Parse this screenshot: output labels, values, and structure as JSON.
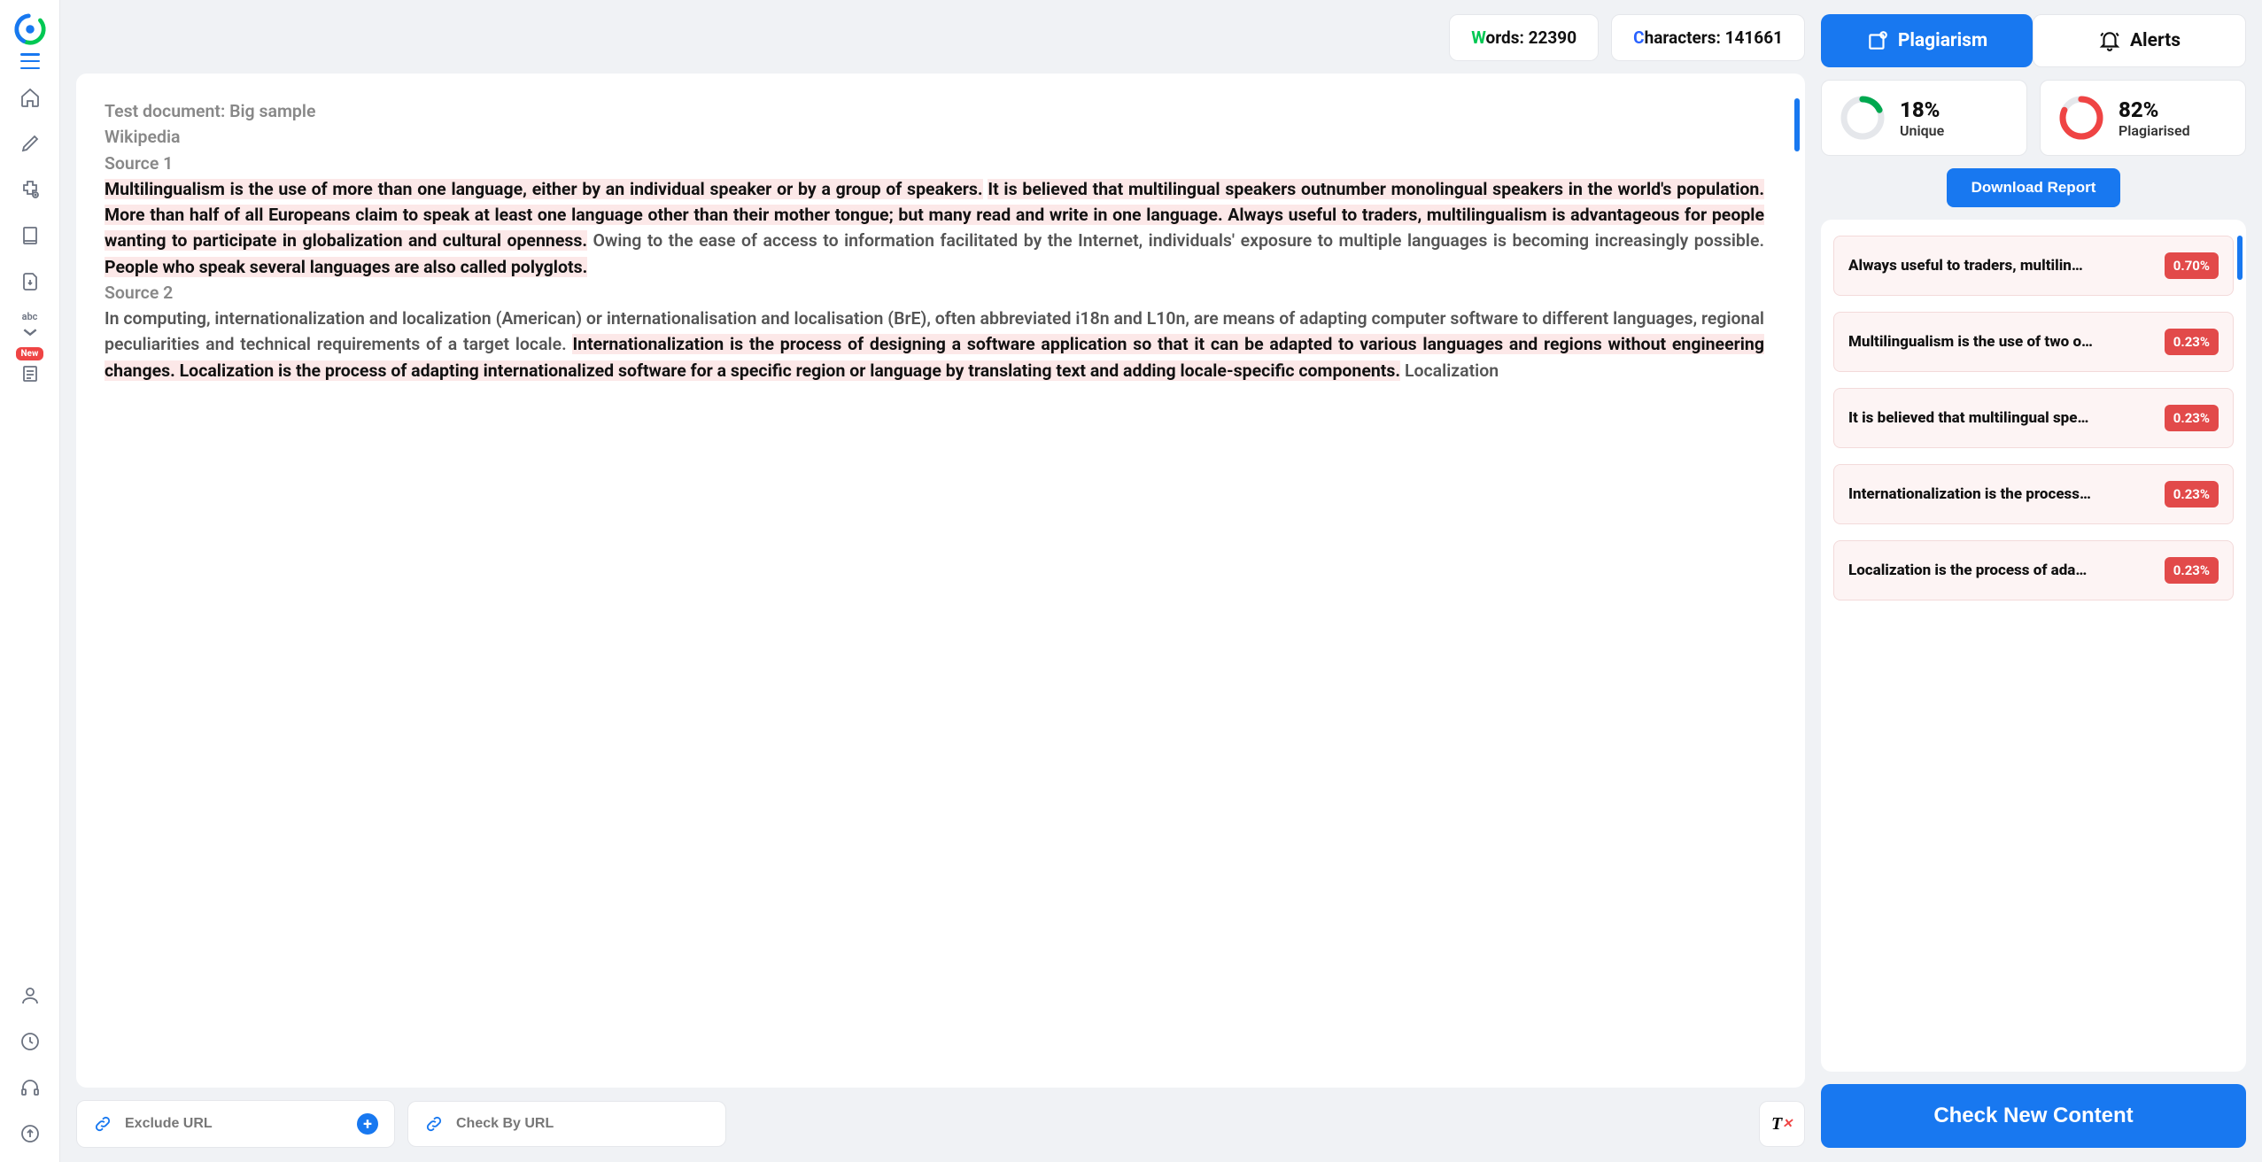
{
  "stats": {
    "words_label": "ords:",
    "words_value": "22390",
    "chars_label": "haracters:",
    "chars_value": "141661"
  },
  "doc": {
    "title_line": "Test document: Big sample",
    "wikipedia": "Wikipedia",
    "source1": "Source 1",
    "p1a": "Multilingualism is the use of more than one language, either by an individual speaker or by a group of speakers.",
    "p1b": "It is believed that multilingual speakers outnumber monolingual speakers in the world's population.",
    "p1c": "More than half of all Europeans claim to speak at least one language other than their mother tongue; but many read and write in one language. Always useful to traders, multilingualism is advantageous for people wanting to participate in globalization and cultural openness.",
    "p1d": " Owing to the ease of access to information facilitated by the Internet, individuals' exposure to multiple languages is becoming increasingly possible. ",
    "p1e": "People who speak several languages are also called polyglots.",
    "source2": "Source 2",
    "p2a": "In computing, internationalization and localization (American) or internationalisation and localisation (BrE), often abbreviated i18n and L10n, are means of adapting computer software to different languages, regional peculiarities and technical requirements of a target locale. ",
    "p2b": "Internationalization is the process of designing a software application so that it can be adapted to various languages and regions without engineering changes. Localization is the process of adapting internationalized software for a specific region or language by translating text and adding locale-specific components.",
    "p2c": " Localization"
  },
  "tabs": {
    "plagiarism": "Plagiarism",
    "alerts": "Alerts"
  },
  "scores": {
    "unique_pct": "18%",
    "unique_lbl": "Unique",
    "plag_pct": "82%",
    "plag_lbl": "Plagiarised"
  },
  "download": "Download Report",
  "matches": [
    {
      "text": "Always useful to traders, multilin…",
      "pct": "0.70%"
    },
    {
      "text": "Multilingualism is the use of two o…",
      "pct": "0.23%"
    },
    {
      "text": "It is believed that multilingual spe…",
      "pct": "0.23%"
    },
    {
      "text": "Internationalization is the process…",
      "pct": "0.23%"
    },
    {
      "text": "Localization is the process of ada…",
      "pct": "0.23%"
    }
  ],
  "check_btn": "Check New Content",
  "exclude_placeholder": "Exclude URL",
  "checkby_placeholder": "Check By URL",
  "new_badge": "New"
}
